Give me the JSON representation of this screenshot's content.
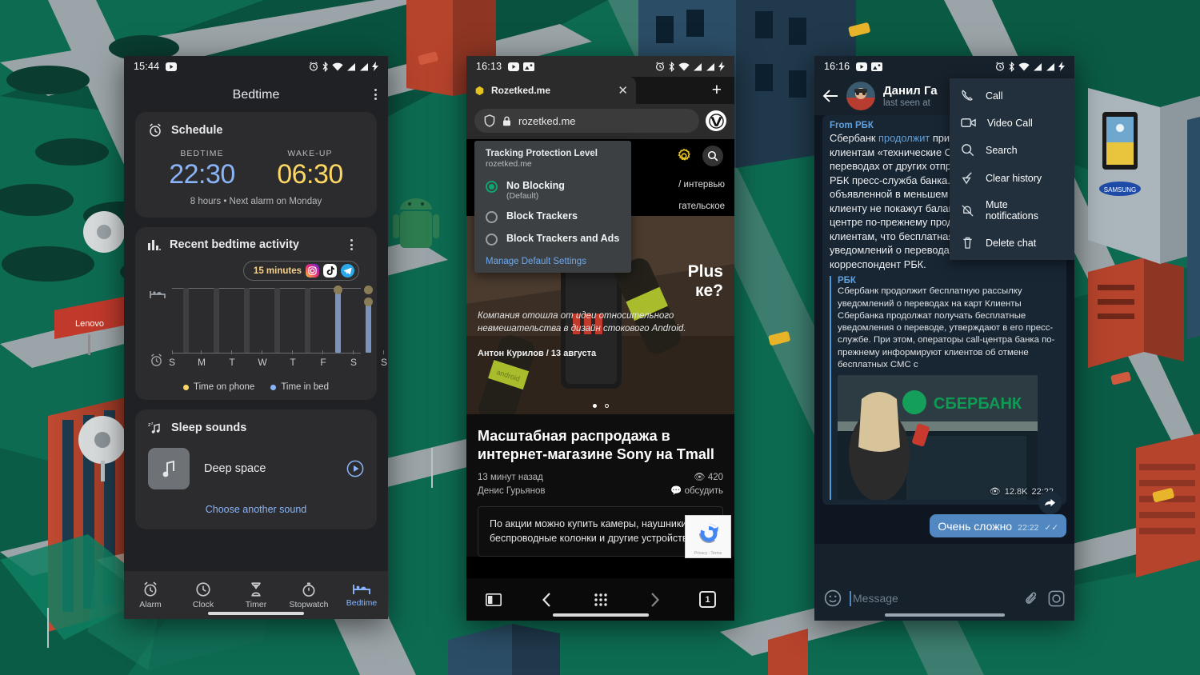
{
  "wallpaper": {
    "description": "isometric city illustration",
    "signs": [
      "Lenovo",
      "SAMSUNG"
    ],
    "colors": {
      "grass": "#0d6b52",
      "road": "#9aa3a8",
      "building_red": "#b6432c",
      "building_blue": "#2b4d66"
    }
  },
  "phone_left": {
    "statusbar": {
      "time": "15:44",
      "left_icons": [
        "youtube-icon"
      ],
      "right_icons": [
        "alarm-icon",
        "bluetooth-icon",
        "wifi-icon",
        "signal-icon",
        "signal-icon",
        "charging-icon"
      ]
    },
    "app_title": "Bedtime",
    "schedule": {
      "title": "Schedule",
      "bedtime_label": "BEDTIME",
      "bedtime_value": "22:30",
      "bedtime_color": "#8ab4f8",
      "wakeup_label": "WAKE-UP",
      "wakeup_value": "06:30",
      "wakeup_color": "#fdd663",
      "summary": "8 hours • Next alarm on Monday"
    },
    "activity": {
      "title": "Recent bedtime activity",
      "pill_text": "15 minutes",
      "pill_apps": [
        "instagram-icon",
        "tiktok-icon",
        "telegram-icon"
      ],
      "legend": [
        {
          "label": "Time on phone",
          "color": "#fdd663"
        },
        {
          "label": "Time in bed",
          "color": "#8ab4f8"
        }
      ]
    },
    "sleep_sounds": {
      "title": "Sleep sounds",
      "sound_name": "Deep space",
      "choose_link": "Choose another sound"
    },
    "bottom_nav": [
      {
        "label": "Alarm",
        "icon": "alarm-icon",
        "active": false
      },
      {
        "label": "Clock",
        "icon": "clock-icon",
        "active": false
      },
      {
        "label": "Timer",
        "icon": "hourglass-icon",
        "active": false
      },
      {
        "label": "Stopwatch",
        "icon": "stopwatch-icon",
        "active": false
      },
      {
        "label": "Bedtime",
        "icon": "bed-icon",
        "active": true
      }
    ]
  },
  "chart_data": {
    "type": "bar",
    "title": "Recent bedtime activity",
    "categories": [
      "S",
      "M",
      "T",
      "W",
      "T",
      "F",
      "S",
      "S"
    ],
    "series": [
      {
        "name": "Time in bed",
        "color": "#8ab4f8",
        "values": [
          0,
          0,
          0,
          0,
          0,
          0.93,
          0.82,
          1.0
        ]
      },
      {
        "name": "Time on phone",
        "color": "#fdd663",
        "values": [
          0,
          0,
          0,
          0,
          0,
          0.06,
          0.1,
          1.0
        ]
      }
    ],
    "inactive_bars": [
      0,
      1,
      2,
      3,
      4
    ],
    "ylabel_top_icon": "bed-icon",
    "ylabel_bottom_icon": "alarm-icon",
    "annotation": "15 minutes",
    "grid": true,
    "legend_position": "bottom"
  },
  "phone_mid": {
    "statusbar": {
      "time": "16:13",
      "left_icons": [
        "youtube-icon",
        "screenshot-icon"
      ],
      "right_icons": [
        "alarm-icon",
        "bluetooth-icon",
        "wifi-icon",
        "signal-icon",
        "signal-icon",
        "charging-icon"
      ]
    },
    "tab": {
      "title": "Rozetked.me",
      "favicon": "hexagon-icon",
      "close": "×"
    },
    "new_tab": "+",
    "urlbar": {
      "shield": "shield-icon",
      "lock": "lock-icon",
      "url": "rozetked.me",
      "browser_badge": "vivaldi-icon"
    },
    "popover": {
      "title": "Tracking Protection Level",
      "subtitle": "rozetked.me",
      "options": [
        {
          "label": "No Blocking",
          "sub": "(Default)",
          "selected": true
        },
        {
          "label": "Block Trackers",
          "sub": "",
          "selected": false
        },
        {
          "label": "Block Trackers and Ads",
          "sub": "",
          "selected": false
        }
      ],
      "link": "Manage Default Settings"
    },
    "site": {
      "nav_tail": "/ интервью",
      "nav_tail2": "гательское",
      "hero_title_tail1": "Plus",
      "hero_title_tail2": "ке?",
      "hero_sub": "Компания отошла от идеи относительного невмешательства в дизайн стокового Android.",
      "hero_by": "Антон Курилов / 13 августа"
    },
    "article": {
      "headline": "Масштабная распродажа в интернет-магазине Sony на Tmall",
      "time_ago": "13 минут назад",
      "author": "Денис Гурьянов",
      "views": "420",
      "comments": "обсудить",
      "excerpt": "По акции можно купить камеры, наушники, беспроводные колонки и другие устройства."
    },
    "recaptcha_label": "Privacy - Terms",
    "browser_bar": {
      "panel": "panel-icon",
      "back": "back-icon",
      "apps": "grid-icon",
      "forward": "forward-icon",
      "tab_count": "1"
    }
  },
  "phone_right": {
    "statusbar": {
      "time": "16:16",
      "left_icons": [
        "youtube-icon",
        "screenshot-icon"
      ],
      "right_icons": [
        "alarm-icon",
        "bluetooth-icon",
        "wifi-icon",
        "signal-icon",
        "signal-icon",
        "charging-icon"
      ]
    },
    "header": {
      "back": "back-arrow-icon",
      "name": "Данил Га",
      "status": "last seen at"
    },
    "menu": [
      {
        "label": "Call",
        "icon": "phone-icon"
      },
      {
        "label": "Video Call",
        "icon": "video-camera-icon"
      },
      {
        "label": "Search",
        "icon": "search-icon"
      },
      {
        "label": "Clear history",
        "icon": "broom-icon"
      },
      {
        "label": "Mute notifications",
        "icon": "mute-bell-icon"
      },
      {
        "label": "Delete chat",
        "icon": "trash-icon"
      }
    ],
    "message": {
      "from_label": "From РБК",
      "body_start": "Сбербанк ",
      "body_link": "продолжит",
      "body_rest": " присылать своим клиентам «технические СМС-сообщения» о переводах от других отправителей, сообщила РБК пресс-служба банка. Отказ от услуги от объявленной в меньшем количестве случаев клиенту не покажут баланс счета. Однако в call-центре по-прежнему продолжают уверять клиентам, что бесплатная рассылка уведомлений о переводах отменена, убедился корреспондент РБК.",
      "quote_title": "РБК",
      "quote_body": "Сбербанк продолжит бесплатную рассылку уведомлений о переводах на карт Клиенты Сбербанка продолжат получать бесплатные уведомления о переводе, утверждают в его пресс-службе. При этом, операторы call-центра банка по-прежнему информируют клиентов об отмене бесплатных СМС с",
      "photo_caption": "СБЕРБАНК",
      "views": "12.8K",
      "time": "22:22"
    },
    "outgoing": {
      "text": "Очень сложно",
      "time": "22:22",
      "ticks": "✓✓"
    },
    "input": {
      "placeholder": "Message",
      "emoji": "emoji-icon",
      "attach": "paperclip-icon",
      "camera": "camera-icon"
    }
  }
}
